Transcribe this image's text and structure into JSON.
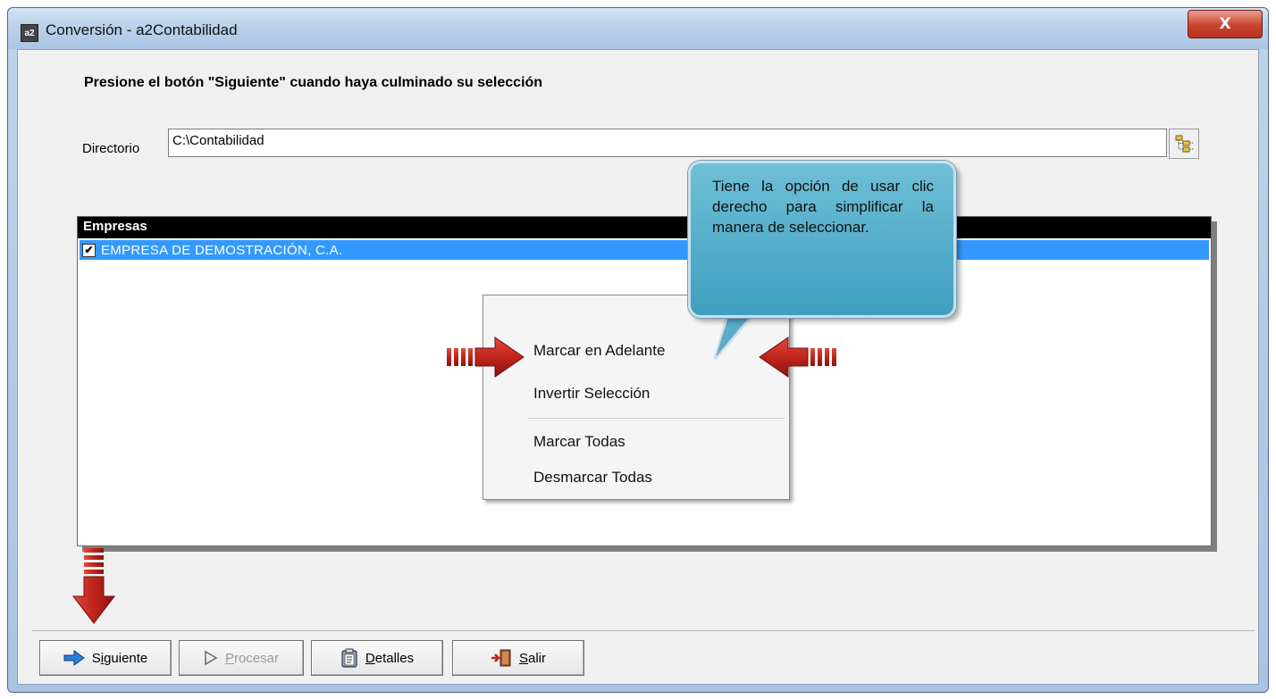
{
  "window": {
    "title": "Conversión - a2Contabilidad",
    "close_label": "X"
  },
  "instruction": "Presione el botón \"Siguiente\" cuando haya culminado su selección",
  "directory": {
    "label": "Directorio",
    "value": "C:\\Contabilidad"
  },
  "list": {
    "header": "Empresas",
    "rows": [
      {
        "label": "EMPRESA DE DEMOSTRACIÓN, C.A.",
        "checked": true
      }
    ]
  },
  "context_menu": {
    "items": [
      "Marcar en Adelante",
      "Invertir Selección",
      "Marcar Todas",
      "Desmarcar Todas"
    ]
  },
  "callout": {
    "text": "Tiene la opción de usar clic derecho para simplificar la manera de seleccionar."
  },
  "buttons": {
    "siguiente": {
      "pre": "S",
      "ul": "i",
      "post": "guiente",
      "enabled": true
    },
    "procesar": {
      "pre": "",
      "ul": "P",
      "post": "rocesar",
      "enabled": false
    },
    "detalles": {
      "pre": "",
      "ul": "D",
      "post": "etalles",
      "enabled": true
    },
    "salir": {
      "pre": "",
      "ul": "S",
      "post": "alir",
      "enabled": true
    }
  },
  "colors": {
    "selection": "#3399ff",
    "callout": "#4aa9c8",
    "arrow": "#c0241c"
  }
}
